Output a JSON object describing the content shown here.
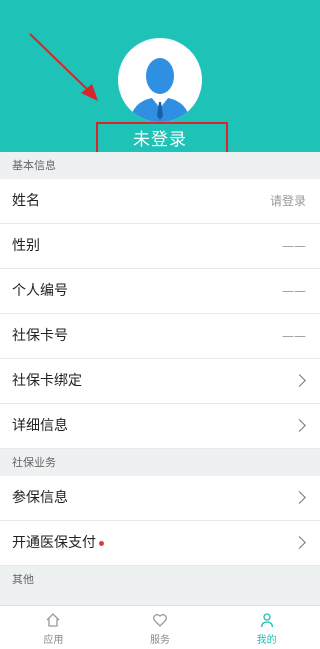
{
  "profile": {
    "login_status": "未登录"
  },
  "sections": {
    "basic": {
      "title": "基本信息",
      "rows": [
        {
          "label": "姓名",
          "value": "请登录"
        },
        {
          "label": "性别",
          "value": "——"
        },
        {
          "label": "个人编号",
          "value": "——"
        },
        {
          "label": "社保卡号",
          "value": "——"
        },
        {
          "label": "社保卡绑定"
        },
        {
          "label": "详细信息"
        }
      ]
    },
    "social": {
      "title": "社保业务",
      "rows": [
        {
          "label": "参保信息"
        },
        {
          "label": "开通医保支付"
        }
      ]
    },
    "other": {
      "title": "其他"
    }
  },
  "tabbar": {
    "items": [
      {
        "label": "应用",
        "icon": "home-icon"
      },
      {
        "label": "服务",
        "icon": "heart-icon"
      },
      {
        "label": "我的",
        "icon": "person-icon",
        "active": true
      }
    ]
  },
  "colors": {
    "header": "#1fc2b6",
    "accent": "#1fbfb2",
    "highlight": "#d7262c",
    "badge": "#e53935"
  }
}
